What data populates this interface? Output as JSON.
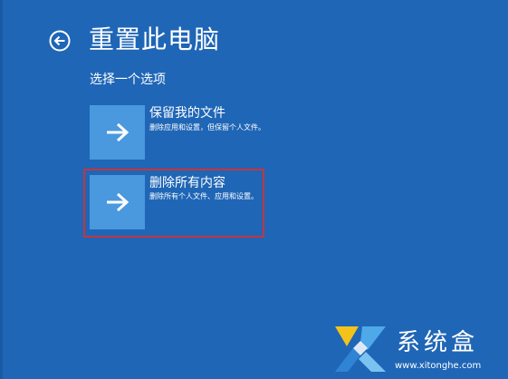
{
  "header": {
    "title": "重置此电脑",
    "back_icon": "back-arrow-circle-icon"
  },
  "subtitle": "选择一个选项",
  "options": [
    {
      "title": "保留我的文件",
      "description": "删除应用和设置，但保留个人文件。",
      "icon": "arrow-right-icon",
      "highlighted": false
    },
    {
      "title": "删除所有内容",
      "description": "删除所有个人文件、应用和设置。",
      "icon": "arrow-right-icon",
      "highlighted": true
    }
  ],
  "watermark": {
    "name": "系统盒",
    "url": "www.xitonghe.com",
    "logo_icon": "xitonghe-logo-icon"
  },
  "colors": {
    "background": "#1f66b6",
    "tile": "#4a98de",
    "highlight_border": "#c7343c",
    "text": "#ffffff"
  }
}
